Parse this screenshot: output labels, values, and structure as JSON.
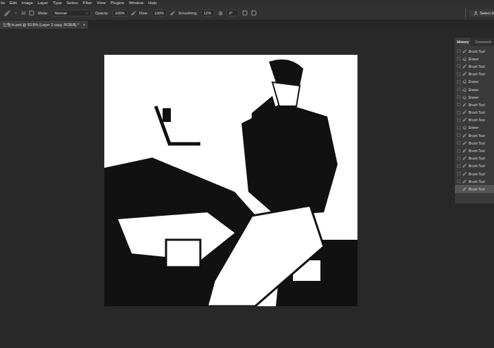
{
  "menu": [
    "ile",
    "Edit",
    "Image",
    "Layer",
    "Type",
    "Select",
    "Filter",
    "View",
    "Plugins",
    "Window",
    "Help"
  ],
  "options": {
    "size": "10",
    "mode_label": "Mode:",
    "mode": "Normal",
    "opacity_label": "Opacity:",
    "opacity": "100%",
    "flow_label": "Flow:",
    "flow": "100%",
    "smoothing_label": "Smoothing:",
    "smoothing": "12%",
    "angle": "0°"
  },
  "share_button": "Select S",
  "document_tab": {
    "title": "인형-b.psd @ 50.8% (Layer 2 copy, RGB/8) *",
    "close": "×"
  },
  "panel": {
    "tabs": [
      {
        "label": "History",
        "selected": true
      },
      {
        "label": "Comments",
        "selected": false
      }
    ],
    "items": [
      {
        "label": "Brush Tool",
        "kind": "brush",
        "selected": false
      },
      {
        "label": "Eraser",
        "kind": "eraser",
        "selected": false
      },
      {
        "label": "Brush Tool",
        "kind": "brush",
        "selected": false
      },
      {
        "label": "Brush Tool",
        "kind": "brush",
        "selected": false
      },
      {
        "label": "Eraser",
        "kind": "eraser",
        "selected": false
      },
      {
        "label": "Eraser",
        "kind": "eraser",
        "selected": false
      },
      {
        "label": "Eraser",
        "kind": "eraser",
        "selected": false
      },
      {
        "label": "Brush Tool",
        "kind": "brush",
        "selected": false
      },
      {
        "label": "Brush Tool",
        "kind": "brush",
        "selected": false
      },
      {
        "label": "Brush Tool",
        "kind": "brush",
        "selected": false
      },
      {
        "label": "Eraser",
        "kind": "eraser",
        "selected": false
      },
      {
        "label": "Brush Tool",
        "kind": "brush",
        "selected": false
      },
      {
        "label": "Brush Tool",
        "kind": "brush",
        "selected": false
      },
      {
        "label": "Brush Tool",
        "kind": "brush",
        "selected": false
      },
      {
        "label": "Brush Tool",
        "kind": "brush",
        "selected": false
      },
      {
        "label": "Brush Tool",
        "kind": "brush",
        "selected": false
      },
      {
        "label": "Brush Tool",
        "kind": "brush",
        "selected": false
      },
      {
        "label": "Brush Tool",
        "kind": "brush",
        "selected": false
      },
      {
        "label": "Brush Tool",
        "kind": "brush",
        "selected": true
      }
    ]
  }
}
